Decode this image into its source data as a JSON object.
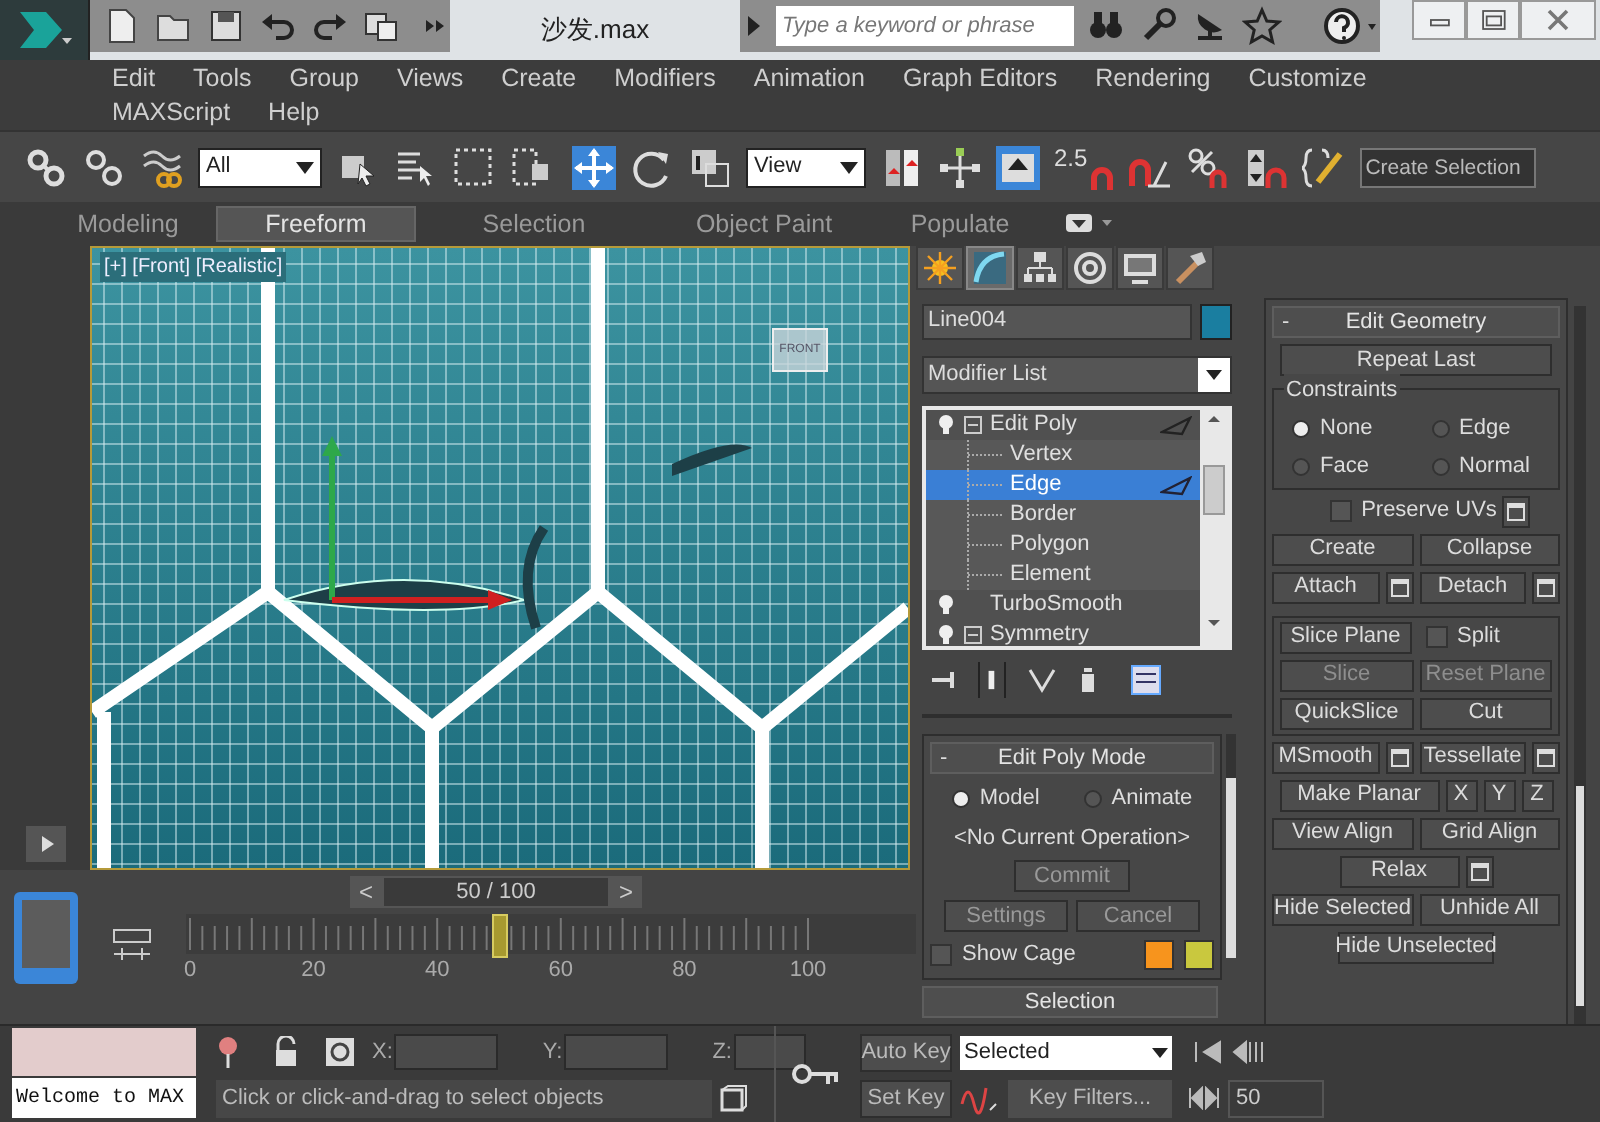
{
  "title_bar": {
    "title": "沙发.max",
    "search": {
      "placeholder": "Type a keyword or phrase"
    }
  },
  "menu_rows": [
    [
      "Edit",
      "Tools",
      "Group",
      "Views",
      "Create",
      "Modifiers",
      "Animation",
      "Graph Editors",
      "Rendering",
      "Customize"
    ],
    [
      "MAXScript",
      "Help"
    ]
  ],
  "toolbar": {
    "selection_filter": "All",
    "reference_coordinates": "View",
    "snap_value": "2.5",
    "named_selection": {
      "placeholder": "Create Selection"
    }
  },
  "ribbon_tabs": [
    {
      "label": "Modeling",
      "selected": false
    },
    {
      "label": "Freeform",
      "selected": true
    },
    {
      "label": "Selection",
      "selected": false
    },
    {
      "label": "Object Paint",
      "selected": false
    },
    {
      "label": "Populate",
      "selected": false
    }
  ],
  "viewport": {
    "label": "[+] [Front] [Realistic]",
    "view_cube": "FRONT"
  },
  "time_slider": {
    "previous": "<",
    "reading": "50 / 100",
    "next": ">",
    "level": 0.5
  },
  "timeline_ticks": [
    "0",
    "20",
    "40",
    "60",
    "80",
    "100"
  ],
  "command_panel": {
    "tabs": [
      {
        "kind": "create",
        "selected": false
      },
      {
        "kind": "modify",
        "selected": true
      },
      {
        "kind": "hierarchy",
        "selected": false
      },
      {
        "kind": "motion",
        "selected": false
      },
      {
        "kind": "display",
        "selected": false
      },
      {
        "kind": "utilities",
        "selected": false
      }
    ],
    "object_name": "Line004",
    "object_swatch": {
      "color": "#1a7ea0"
    },
    "modifier_list": "Modifier List",
    "stack": [
      {
        "label": "Edit Poly",
        "expanded": true,
        "selected": false,
        "children": [
          {
            "label": "Vertex",
            "selected": false
          },
          {
            "label": "Edge",
            "selected": true
          },
          {
            "label": "Border",
            "selected": false
          },
          {
            "label": "Polygon",
            "selected": false
          },
          {
            "label": "Element",
            "selected": false
          }
        ]
      },
      {
        "label": "TurboSmooth",
        "expanded": false,
        "selected": false
      },
      {
        "label": "Symmetry",
        "expanded": true,
        "selected": false
      }
    ],
    "edit_poly_mode": {
      "collapse": "-",
      "title": "Edit Poly Mode",
      "modes": [
        {
          "label": "Model",
          "selected": true
        },
        {
          "label": "Animate",
          "selected": false
        }
      ],
      "operation": "<No Current Operation>",
      "commit": "Commit",
      "buttons": [
        "Settings",
        "Cancel"
      ],
      "show_cage": {
        "label": "Show Cage",
        "checked": false
      },
      "cage_swatches": [
        {
          "color": "#f7941d"
        },
        {
          "color": "#c9c83e"
        }
      ]
    },
    "selection_rollout": "Selection",
    "edit_geometry": {
      "collapse": "-",
      "title": "Edit Geometry",
      "sections": [
        {
          "kind": "plain",
          "rows": [
            [
              {
                "kind": "button",
                "label": "Repeat Last",
                "disabled": false
              }
            ]
          ]
        },
        {
          "kind": "frame",
          "title": "Constraints",
          "rows": [
            [
              {
                "kind": "radio",
                "label": "None",
                "selected": true
              },
              {
                "kind": "radio",
                "label": "Edge",
                "selected": false
              }
            ],
            [
              {
                "kind": "radio",
                "label": "Face",
                "selected": false
              },
              {
                "kind": "radio",
                "label": "Normal",
                "selected": false
              }
            ]
          ]
        },
        {
          "kind": "plain",
          "rows": [
            [
              {
                "kind": "check",
                "label": "Preserve UVs",
                "checked": false,
                "settings": true
              }
            ],
            [
              {
                "kind": "button",
                "label": "Create",
                "disabled": false
              },
              {
                "kind": "button",
                "label": "Collapse",
                "disabled": false
              }
            ],
            [
              {
                "kind": "button",
                "label": "Attach",
                "disabled": false,
                "settings": true
              },
              {
                "kind": "button",
                "label": "Detach",
                "disabled": false,
                "settings": true
              }
            ]
          ]
        },
        {
          "kind": "frame",
          "rows": [
            [
              {
                "kind": "button",
                "label": "Slice Plane",
                "disabled": false
              },
              {
                "kind": "check",
                "label": "Split",
                "checked": false
              }
            ],
            [
              {
                "kind": "button",
                "label": "Slice",
                "disabled": true
              },
              {
                "kind": "button",
                "label": "Reset Plane",
                "disabled": true
              }
            ],
            [
              {
                "kind": "button",
                "label": "QuickSlice",
                "disabled": false
              },
              {
                "kind": "button",
                "label": "Cut",
                "disabled": false
              }
            ]
          ]
        },
        {
          "kind": "plain",
          "rows": [
            [
              {
                "kind": "button",
                "label": "MSmooth",
                "disabled": false,
                "settings": true
              },
              {
                "kind": "button",
                "label": "Tessellate",
                "disabled": false,
                "settings": true
              }
            ],
            [
              {
                "kind": "button",
                "label": "Make Planar",
                "disabled": false
              },
              {
                "kind": "button",
                "label": "X",
                "disabled": false
              },
              {
                "kind": "button",
                "label": "Y",
                "disabled": false
              },
              {
                "kind": "button",
                "label": "Z",
                "disabled": false
              }
            ],
            [
              {
                "kind": "button",
                "label": "View Align",
                "disabled": false
              },
              {
                "kind": "button",
                "label": "Grid Align",
                "disabled": false
              }
            ],
            [
              {
                "kind": "button",
                "label": "Relax",
                "disabled": false,
                "settings": true
              }
            ],
            [
              {
                "kind": "button",
                "label": "Hide Selected",
                "disabled": false
              },
              {
                "kind": "button",
                "label": "Unhide All",
                "disabled": false
              }
            ],
            [
              {
                "kind": "button",
                "label": "Hide Unselected",
                "disabled": false
              }
            ]
          ]
        }
      ]
    }
  },
  "status_bar": {
    "listener": "Welcome to MAX",
    "x_label": "X:",
    "y_label": "Y:",
    "z_label": "Z:",
    "prompt": "Click or click-and-drag to select objects"
  },
  "animation_controls": {
    "auto_key": "Auto Key",
    "key_mode": "Selected",
    "set_key": "Set Key",
    "key_filters": "Key Filters...",
    "frame": "50"
  }
}
